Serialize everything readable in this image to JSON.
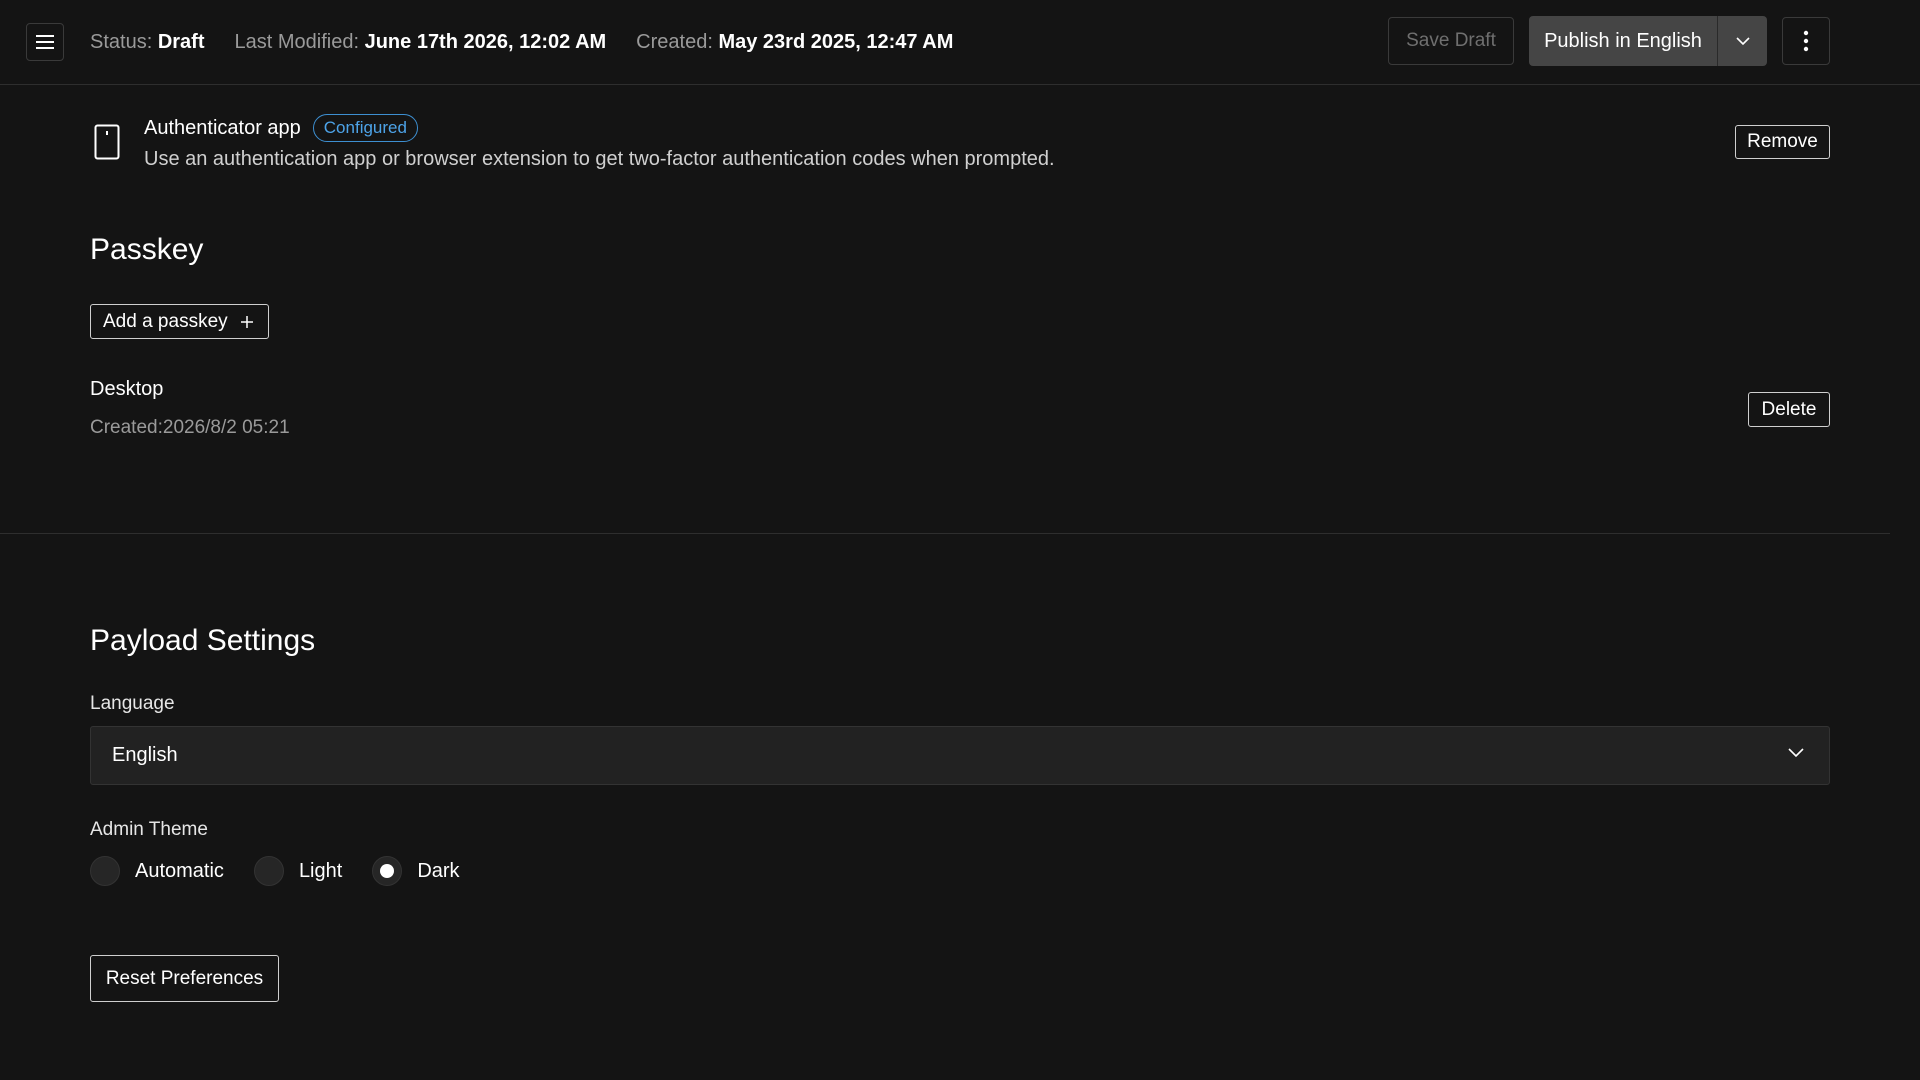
{
  "header": {
    "status_label": "Status:",
    "status_value": "Draft",
    "modified_label": "Last Modified:",
    "modified_value": "June 17th 2026, 12:02 AM",
    "created_label": "Created:",
    "created_value": "May 23rd 2025, 12:47 AM",
    "save_draft_label": "Save Draft",
    "publish_label": "Publish in English",
    "icons": {
      "menu": "hamburger-menu-icon",
      "publish_options": "chevron-down-icon",
      "more": "vertical-ellipsis-icon"
    }
  },
  "authenticator": {
    "icon": "mobile-device-icon",
    "title": "Authenticator app",
    "badge": "Configured",
    "description": "Use an authentication app or browser extension to get two-factor authentication codes when prompted.",
    "remove_label": "Remove"
  },
  "passkey": {
    "title": "Passkey",
    "add_label": "Add a passkey",
    "items": [
      {
        "name": "Desktop",
        "created": "Created:2026/8/2 05:21",
        "delete_label": "Delete"
      }
    ]
  },
  "payload_settings": {
    "title": "Payload Settings",
    "language_label": "Language",
    "language_value": "English",
    "theme_label": "Admin Theme",
    "theme_options": [
      "Automatic",
      "Light",
      "Dark"
    ],
    "theme_selected": "Dark",
    "reset_label": "Reset Preferences"
  },
  "colors": {
    "background": "#141414",
    "badge": "#4da3e8",
    "primary_button": "#454545",
    "muted_text": "#9a9a9a"
  }
}
